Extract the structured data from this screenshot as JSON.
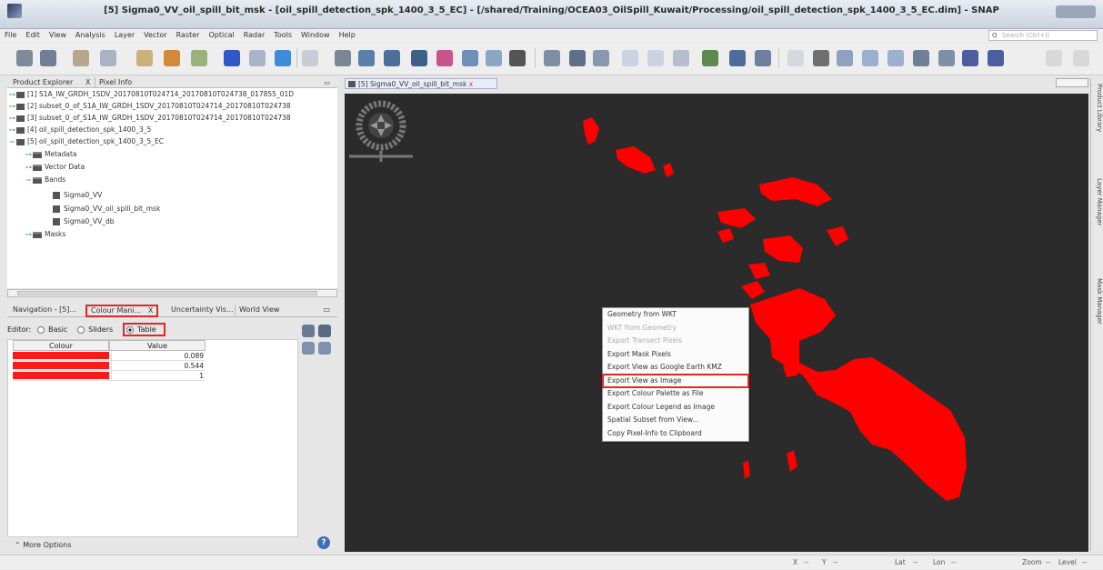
{
  "window": {
    "title": "[5] Sigma0_VV_oil_spill_bit_msk - [oil_spill_detection_spk_1400_3_5_EC] - [/shared/Training/OCEA03_OilSpill_Kuwait/Processing/oil_spill_detection_spk_1400_3_5_EC.dim] - SNAP"
  },
  "menu": {
    "items": [
      "File",
      "Edit",
      "View",
      "Analysis",
      "Layer",
      "Vector",
      "Raster",
      "Optical",
      "Radar",
      "Tools",
      "Window",
      "Help"
    ],
    "search_placeholder": "Search (Ctrl+I)"
  },
  "product_explorer": {
    "tabs": [
      "Product Explorer",
      "X",
      "Pixel Info"
    ],
    "products": [
      "[1] S1A_IW_GRDH_1SDV_20170810T024714_20170810T024738_017855_01D",
      "[2] subset_0_of_S1A_IW_GRDH_1SDV_20170810T024714_20170810T024738",
      "[3] subset_0_of_S1A_IW_GRDH_1SDV_20170810T024714_20170810T024738",
      "[4] oil_spill_detection_spk_1400_3_5",
      "[5] oil_spill_detection_spk_1400_3_5_EC"
    ],
    "folders": [
      "Metadata",
      "Vector Data",
      "Bands"
    ],
    "bands": [
      "Sigma0_VV",
      "Sigma0_VV_oil_spill_bit_msk",
      "Sigma0_VV_db"
    ],
    "masks_label": "Masks"
  },
  "tool_panel": {
    "tabs": [
      "Navigation - [5]...",
      "Colour Mani...",
      "X",
      "Uncertainty Vis...",
      "World View"
    ],
    "editor_label": "Editor:",
    "modes": [
      "Basic",
      "Sliders",
      "Table"
    ],
    "selected_mode": "Table",
    "table_headers": [
      "Colour",
      "Value"
    ],
    "table_rows": [
      {
        "colour": "#ff1a1a",
        "value": "0.089"
      },
      {
        "colour": "#ff1a1a",
        "value": "0.544"
      },
      {
        "colour": "#ff1a1a",
        "value": "1"
      }
    ],
    "more_options": "More Options",
    "help_glyph": "?"
  },
  "image_view": {
    "tab_label": "[5] Sigma0_VV_oil_spill_bit_msk",
    "tab_close": "x",
    "spill_color": "#ff0000",
    "background_color": "#2b2b2b"
  },
  "context_menu": {
    "items": [
      {
        "label": "Geometry from WKT",
        "enabled": true
      },
      {
        "label": "WKT from Geometry",
        "enabled": false
      },
      {
        "label": "Export Transect Pixels",
        "enabled": false
      },
      {
        "label": "Export Mask Pixels",
        "enabled": true
      },
      {
        "label": "Export View as Google Earth KMZ",
        "enabled": true
      },
      {
        "label": "Export View as Image",
        "enabled": true
      },
      {
        "label": "Export Colour Palette as File",
        "enabled": true
      },
      {
        "label": "Export Colour Legend as Image",
        "enabled": true
      },
      {
        "label": "Spatial Subset from View...",
        "enabled": true
      },
      {
        "label": "Copy Pixel-Info to Clipboard",
        "enabled": true
      }
    ],
    "highlighted": "Export View as Image"
  },
  "side_panels": [
    "Product Library",
    "Layer Manager",
    "Mask Manager"
  ],
  "status_bar": {
    "x": "X",
    "x_val": "--",
    "y": "Y",
    "y_val": "--",
    "lat": "Lat",
    "lat_val": "--",
    "lon": "Lon",
    "lon_val": "--",
    "zoom": "Zoom",
    "zoom_val": "--",
    "level": "Level",
    "level_val": "--"
  }
}
